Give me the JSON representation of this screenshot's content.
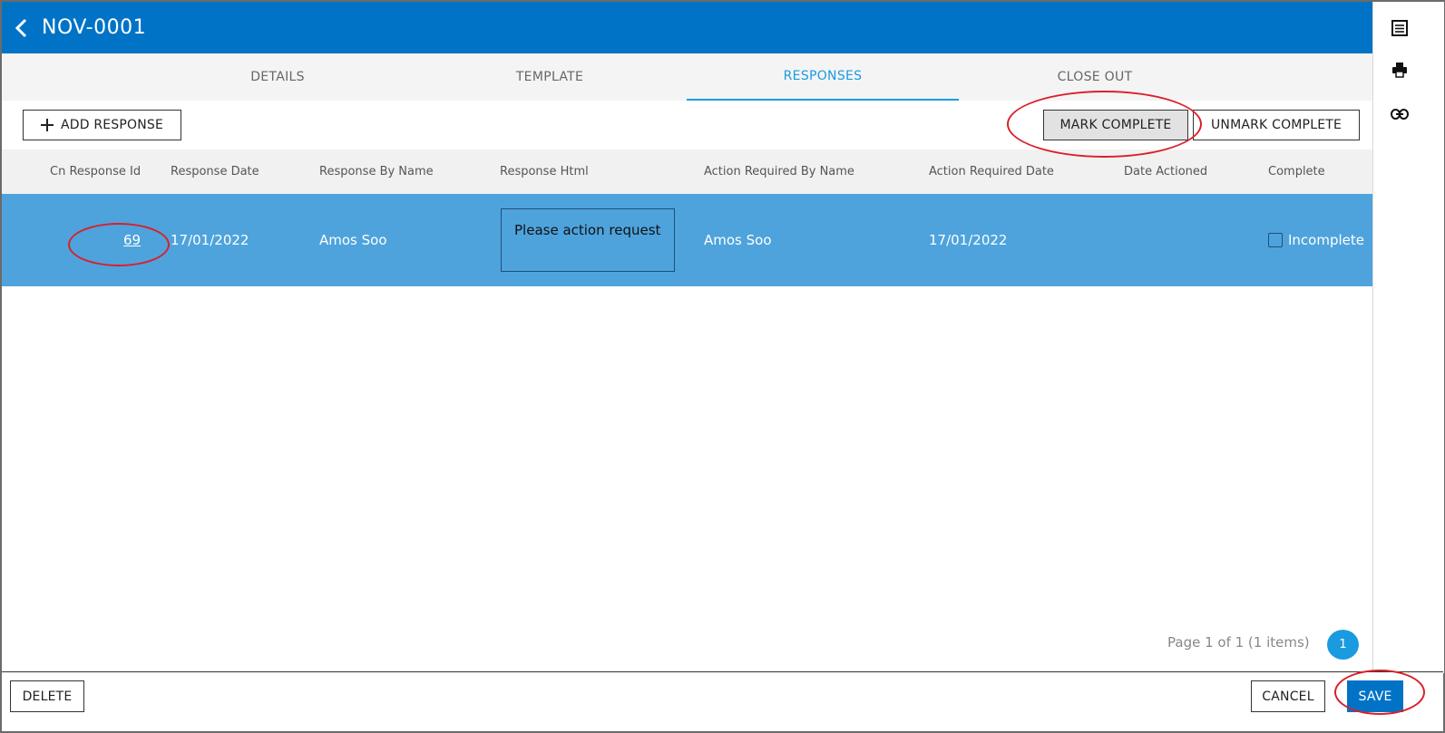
{
  "header": {
    "title": "NOV-0001"
  },
  "tabs": [
    {
      "label": "DETAILS"
    },
    {
      "label": "TEMPLATE"
    },
    {
      "label": "RESPONSES"
    },
    {
      "label": "CLOSE OUT"
    }
  ],
  "active_tab": "RESPONSES",
  "toolbar": {
    "add_label": "ADD RESPONSE",
    "mark_label": "MARK COMPLETE",
    "unmark_label": "UNMARK COMPLETE"
  },
  "grid": {
    "columns": [
      "Cn Response Id",
      "Response Date",
      "Response By Name",
      "Response Html",
      "Action Required By Name",
      "Action Required Date",
      "Date Actioned",
      "Complete"
    ],
    "rows": [
      {
        "id": "69",
        "response_date": "17/01/2022",
        "response_by": "Amos Soo",
        "response_html": "Please action request",
        "action_by": "Amos Soo",
        "action_date": "17/01/2022",
        "date_actioned": "",
        "complete_label": "Incomplete",
        "complete_checked": false
      }
    ]
  },
  "pager": {
    "text": "Page 1 of 1 (1 items)",
    "current": "1"
  },
  "footer": {
    "delete_label": "DELETE",
    "cancel_label": "CANCEL",
    "save_label": "SAVE"
  },
  "colors": {
    "header": "#0173c7",
    "selected_row": "#4ea3dc",
    "accent": "#1a9be0",
    "annotation": "#d9202a"
  },
  "rail_icons": [
    "list-icon",
    "print-icon",
    "link-icon"
  ]
}
